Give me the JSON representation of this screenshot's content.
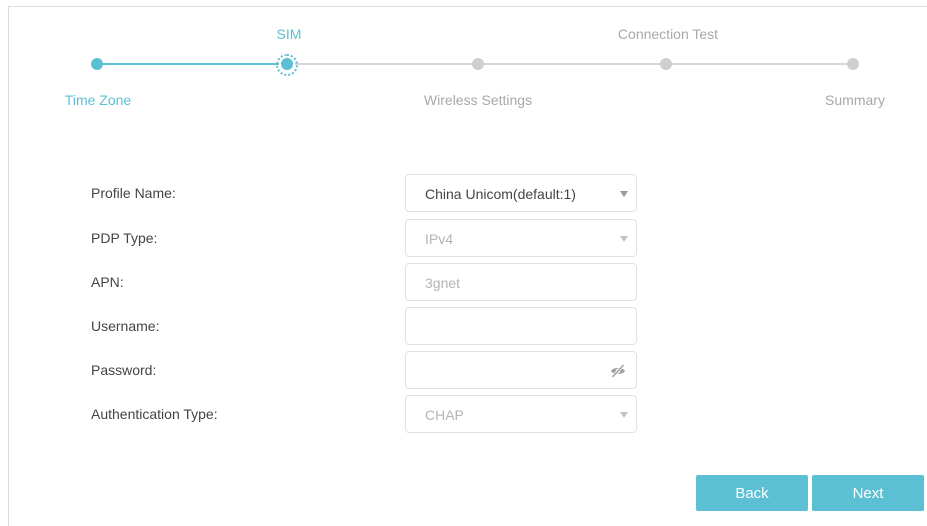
{
  "wizard": {
    "steps": [
      {
        "label": "Time Zone",
        "state": "done"
      },
      {
        "label": "SIM",
        "state": "current"
      },
      {
        "label": "Wireless Settings",
        "state": "pending"
      },
      {
        "label": "Connection Test",
        "state": "pending"
      },
      {
        "label": "Summary",
        "state": "pending"
      }
    ]
  },
  "form": {
    "profile_name": {
      "label": "Profile Name:",
      "value": "China Unicom(default:1)"
    },
    "pdp_type": {
      "label": "PDP Type:",
      "value": "IPv4"
    },
    "apn": {
      "label": "APN:",
      "value": "3gnet"
    },
    "username": {
      "label": "Username:",
      "value": ""
    },
    "password": {
      "label": "Password:",
      "value": ""
    },
    "auth_type": {
      "label": "Authentication Type:",
      "value": "CHAP"
    }
  },
  "buttons": {
    "back": "Back",
    "next": "Next"
  },
  "colors": {
    "accent": "#5bc0d3",
    "inactive": "#d6d6d6",
    "label_text": "#444444",
    "muted_text": "#b4b4b4"
  },
  "icons": {
    "select_caret": "caret-down-icon",
    "password_visibility": "eye-off-icon",
    "current_step_marker": "dotted-ring-icon"
  }
}
